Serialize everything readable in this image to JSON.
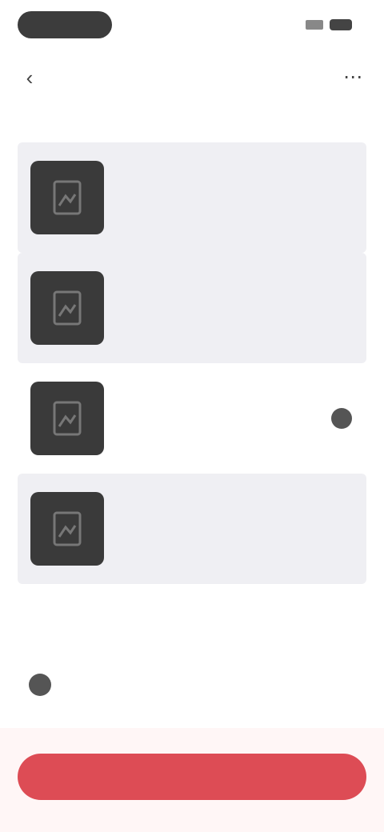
{
  "nav": {
    "title": "",
    "back_icon": "chevron-left-icon",
    "menu_icon": "more-icon"
  },
  "items": [
    {
      "label": "",
      "selected": false
    },
    {
      "label": "",
      "selected": false
    },
    {
      "label": "",
      "selected": true
    },
    {
      "label": "",
      "selected": false
    }
  ],
  "confirm": {
    "text": ""
  },
  "cta": {
    "label": ""
  },
  "colors": {
    "accent": "#dd4c55",
    "list_bg": "#efeff3",
    "thumb_bg": "#3a3a3a"
  }
}
